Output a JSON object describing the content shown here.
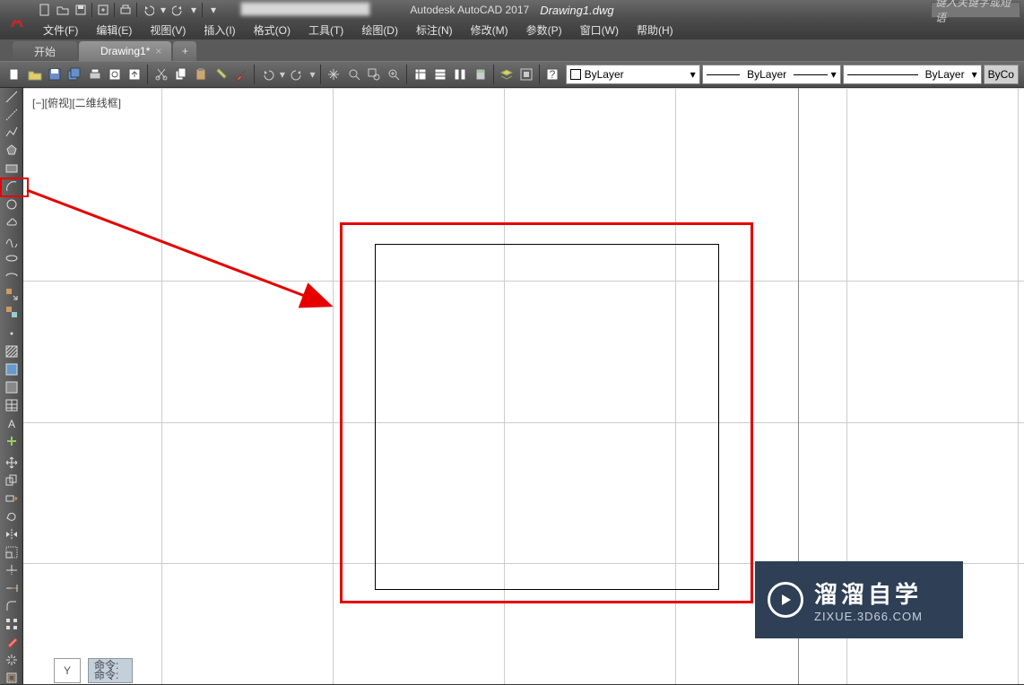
{
  "title": {
    "app": "Autodesk AutoCAD 2017",
    "doc": "Drawing1.dwg"
  },
  "search_placeholder": "键入关键字或短语",
  "menu": [
    {
      "l": "文件(F)"
    },
    {
      "l": "编辑(E)"
    },
    {
      "l": "视图(V)"
    },
    {
      "l": "插入(I)"
    },
    {
      "l": "格式(O)"
    },
    {
      "l": "工具(T)"
    },
    {
      "l": "绘图(D)"
    },
    {
      "l": "标注(N)"
    },
    {
      "l": "修改(M)"
    },
    {
      "l": "参数(P)"
    },
    {
      "l": "窗口(W)"
    },
    {
      "l": "帮助(H)"
    }
  ],
  "tabs": {
    "start": "开始",
    "active": "Drawing1*"
  },
  "layer_controls": {
    "color": "ByLayer",
    "linetype": "ByLayer",
    "lineweight": "ByLayer",
    "bycolor_btn": "ByCo"
  },
  "view_label": "[−][俯视][二维线框]",
  "cmd": {
    "y_label": "Y",
    "line1": "命令:",
    "line2": "命令:"
  },
  "watermark": {
    "big": "溜溜自学",
    "small": "ZIXUE.3D66.COM"
  },
  "qat_icons": [
    "new-icon",
    "open-icon",
    "save-icon",
    "saveas-icon",
    "plot-icon",
    "undo-icon",
    "redo-icon"
  ],
  "toolbar_icons": [
    "new-icon",
    "open-icon",
    "save-icon",
    "saveall-icon",
    "plot-icon",
    "preview-icon",
    "publish-icon",
    "sep",
    "cut-icon",
    "copy-icon",
    "paste-icon",
    "match-icon",
    "brush-icon",
    "sep",
    "undo-icon",
    "redo-icon",
    "sep",
    "pan-icon",
    "zoom-prev-icon",
    "zoom-window-icon",
    "zoom-realtime-icon",
    "sep",
    "properties-icon",
    "sheet-icon",
    "tool-palette-icon",
    "calculator-icon",
    "sep",
    "layer-props-icon",
    "block-icon",
    "sep",
    "help-icon"
  ],
  "vtoolbar_icons": [
    "line-icon",
    "construction-line-icon",
    "polyline-icon",
    "polygon-icon",
    "rectangle-icon",
    "arc-icon",
    "circle-icon",
    "revision-cloud-icon",
    "spline-icon",
    "ellipse-icon",
    "ellipse-arc-icon",
    "insert-block-icon",
    "make-block-icon",
    "point-icon",
    "hatch-icon",
    "gradient-icon",
    "region-icon",
    "table-icon",
    "mtext-icon",
    "addselected-icon",
    "sep",
    "move-icon",
    "copy2-icon",
    "stretch-icon",
    "rotate-icon",
    "mirror-icon",
    "scale-icon",
    "trim-icon",
    "extend-icon",
    "fillet-icon",
    "array-icon",
    "erase-icon",
    "explode-icon",
    "offset-icon"
  ]
}
